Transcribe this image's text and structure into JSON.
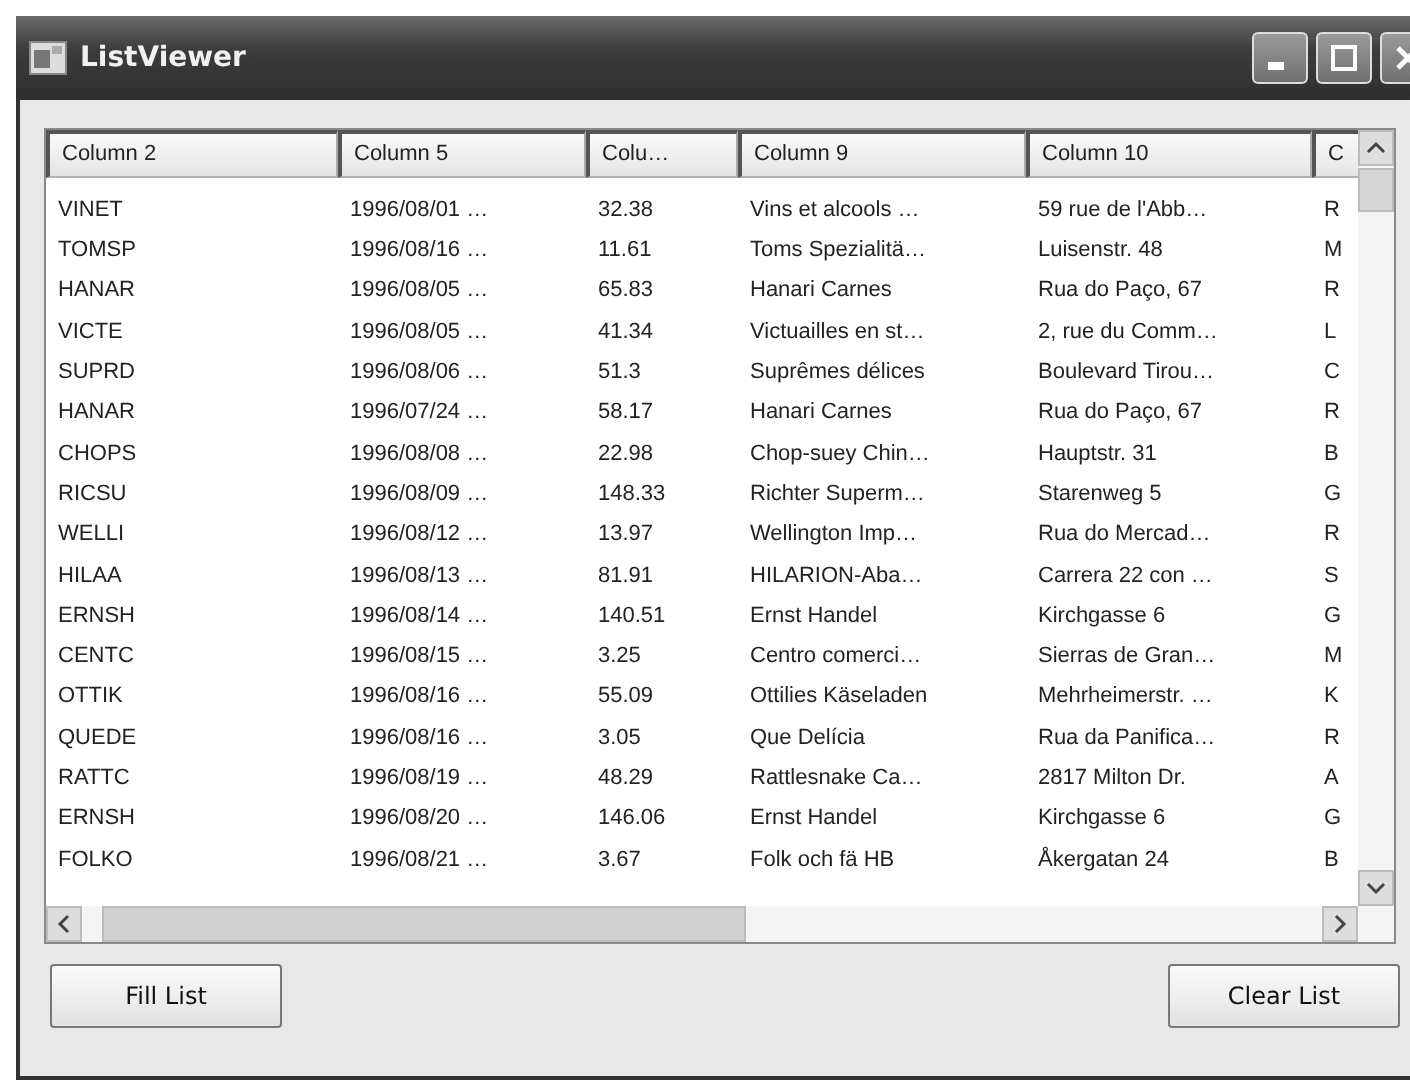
{
  "window": {
    "title": "ListViewer"
  },
  "list": {
    "columns": [
      "Column 2",
      "Column 5",
      "Colu…",
      "Column 9",
      "Column 10",
      "C"
    ],
    "rows": [
      [
        "VINET",
        "1996/08/01 …",
        "32.38",
        "Vins et alcools …",
        "59 rue de l'Abb…",
        "R"
      ],
      [
        "TOMSP",
        "1996/08/16 …",
        "11.61",
        "Toms Spezialitä…",
        "Luisenstr. 48",
        "M"
      ],
      [
        "HANAR",
        "1996/08/05 …",
        "65.83",
        "Hanari Carnes",
        "Rua do Paço, 67",
        "R"
      ],
      [
        "VICTE",
        "1996/08/05 …",
        "41.34",
        "Victuailles en st…",
        "2, rue du Comm…",
        "L"
      ],
      [
        "SUPRD",
        "1996/08/06 …",
        "51.3",
        "Suprêmes délices",
        "Boulevard Tirou…",
        "C"
      ],
      [
        "HANAR",
        "1996/07/24 …",
        "58.17",
        "Hanari Carnes",
        "Rua do Paço, 67",
        "R"
      ],
      [
        "CHOPS",
        "1996/08/08 …",
        "22.98",
        "Chop-suey Chin…",
        "Hauptstr. 31",
        "B"
      ],
      [
        "RICSU",
        "1996/08/09 …",
        "148.33",
        "Richter Superm…",
        "Starenweg 5",
        "G"
      ],
      [
        "WELLI",
        "1996/08/12 …",
        "13.97",
        "Wellington Imp…",
        "Rua do Mercad…",
        "R"
      ],
      [
        "HILAA",
        "1996/08/13 …",
        "81.91",
        "HILARION-Aba…",
        "Carrera 22 con …",
        "S"
      ],
      [
        "ERNSH",
        "1996/08/14 …",
        "140.51",
        "Ernst Handel",
        "Kirchgasse 6",
        "G"
      ],
      [
        "CENTC",
        "1996/08/15 …",
        "3.25",
        "Centro comerci…",
        "Sierras de Gran…",
        "M"
      ],
      [
        "OTTIK",
        "1996/08/16 …",
        "55.09",
        "Ottilies Käseladen",
        "Mehrheimerstr. …",
        "K"
      ],
      [
        "QUEDE",
        "1996/08/16 …",
        "3.05",
        "Que Delícia",
        "Rua da Panifica…",
        "R"
      ],
      [
        "RATTC",
        "1996/08/19 …",
        "48.29",
        "Rattlesnake Ca…",
        "2817 Milton Dr.",
        "A"
      ],
      [
        "ERNSH",
        "1996/08/20 …",
        "146.06",
        "Ernst Handel",
        "Kirchgasse 6",
        "G"
      ],
      [
        "FOLKO",
        "1996/08/21 …",
        "3.67",
        "Folk och fä HB",
        "Åkergatan 24",
        "B"
      ]
    ]
  },
  "buttons": [
    "Fill List",
    "Clear List"
  ]
}
